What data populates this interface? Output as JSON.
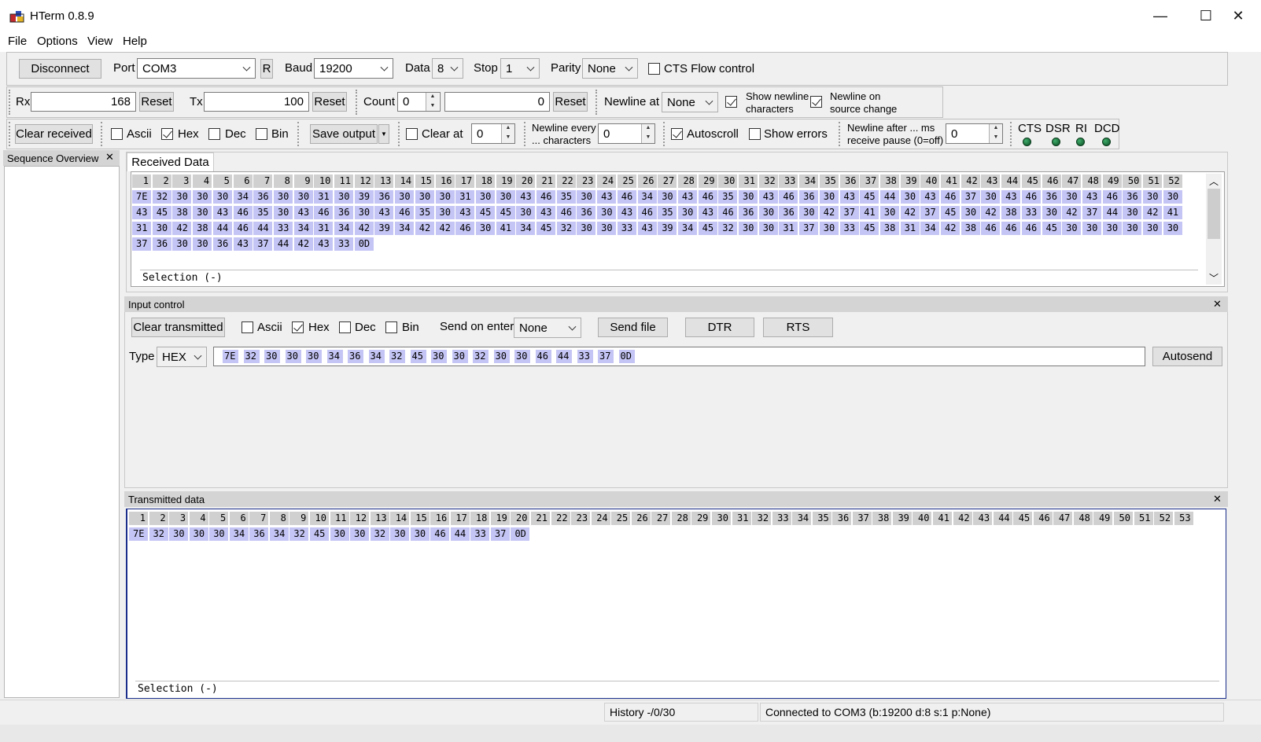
{
  "window": {
    "title": "HTerm 0.8.9",
    "minimize_glyph": "—",
    "maximize_glyph": "☐",
    "close_glyph": "✕"
  },
  "menu": [
    "File",
    "Options",
    "View",
    "Help"
  ],
  "connection": {
    "disconnect_label": "Disconnect",
    "port_label": "Port",
    "port_value": "COM3",
    "refresh_label": "R",
    "baud_label": "Baud",
    "baud_value": "19200",
    "data_label": "Data",
    "data_value": "8",
    "stop_label": "Stop",
    "stop_value": "1",
    "parity_label": "Parity",
    "parity_value": "None",
    "cts_label": "CTS Flow control",
    "cts_checked": false
  },
  "counters": {
    "rx_label": "Rx",
    "rx_value": "168",
    "rx_reset": "Reset",
    "tx_label": "Tx",
    "tx_value": "100",
    "tx_reset": "Reset",
    "count_label": "Count",
    "count_value": "0",
    "count_total": "0",
    "count_reset": "Reset",
    "newline_at_label": "Newline at",
    "newline_at_value": "None",
    "show_newline_label_1": "Show newline",
    "show_newline_label_2": "characters",
    "show_newline_checked": true,
    "newline_source_label_1": "Newline on",
    "newline_source_label_2": "source change",
    "newline_source_checked": true
  },
  "received_toolbar": {
    "clear_received": "Clear received",
    "ascii_label": "Ascii",
    "ascii_checked": false,
    "hex_label": "Hex",
    "hex_checked": true,
    "dec_label": "Dec",
    "dec_checked": false,
    "bin_label": "Bin",
    "bin_checked": false,
    "save_output": "Save output",
    "clear_at_label": "Clear at",
    "clear_at_checked": false,
    "clear_at_value": "0",
    "newline_every_label_1": "Newline every",
    "newline_every_label_2": "... characters",
    "newline_every_value": "0",
    "autoscroll_label": "Autoscroll",
    "autoscroll_checked": true,
    "show_errors_label": "Show errors",
    "show_errors_checked": false,
    "newline_after_label_1": "Newline after ... ms",
    "newline_after_label_2": "receive pause (0=off)",
    "newline_after_value": "0",
    "signals": [
      "CTS",
      "DSR",
      "RI",
      "DCD"
    ]
  },
  "sequence_overview": {
    "title": "Sequence Overview",
    "close_glyph": "✕"
  },
  "received": {
    "tab_label": "Received Data",
    "index_row_count": 52,
    "rows": [
      [
        "7E",
        "32",
        "30",
        "30",
        "30",
        "34",
        "36",
        "30",
        "30",
        "31",
        "30",
        "39",
        "36",
        "30",
        "30",
        "30",
        "31",
        "30",
        "30",
        "43",
        "46",
        "35",
        "30",
        "43",
        "46",
        "34",
        "30",
        "43",
        "46",
        "35",
        "30",
        "43",
        "46",
        "36",
        "30",
        "43",
        "45",
        "44",
        "30",
        "43",
        "46",
        "37",
        "30",
        "43",
        "46",
        "36",
        "30",
        "43",
        "46",
        "36",
        "30",
        "30"
      ],
      [
        "43",
        "45",
        "38",
        "30",
        "43",
        "46",
        "35",
        "30",
        "43",
        "46",
        "36",
        "30",
        "43",
        "46",
        "35",
        "30",
        "43",
        "45",
        "45",
        "30",
        "43",
        "46",
        "36",
        "30",
        "43",
        "46",
        "35",
        "30",
        "43",
        "46",
        "36",
        "30",
        "36",
        "30",
        "42",
        "37",
        "41",
        "30",
        "42",
        "37",
        "45",
        "30",
        "42",
        "38",
        "33",
        "30",
        "42",
        "37",
        "44",
        "30",
        "42",
        "41"
      ],
      [
        "31",
        "30",
        "42",
        "38",
        "44",
        "46",
        "44",
        "33",
        "34",
        "31",
        "34",
        "42",
        "39",
        "34",
        "42",
        "42",
        "46",
        "30",
        "41",
        "34",
        "45",
        "32",
        "30",
        "30",
        "33",
        "43",
        "39",
        "34",
        "45",
        "32",
        "30",
        "30",
        "31",
        "37",
        "30",
        "33",
        "45",
        "38",
        "31",
        "34",
        "42",
        "38",
        "46",
        "46",
        "46",
        "45",
        "30",
        "30",
        "30",
        "30",
        "30",
        "30"
      ],
      [
        "37",
        "36",
        "30",
        "30",
        "36",
        "43",
        "37",
        "44",
        "42",
        "43",
        "33",
        "0D"
      ]
    ],
    "selection_text": "Selection (-)"
  },
  "input_control": {
    "header": "Input control",
    "close_glyph": "✕",
    "clear_transmitted": "Clear transmitted",
    "ascii_label": "Ascii",
    "ascii_checked": false,
    "hex_label": "Hex",
    "hex_checked": true,
    "dec_label": "Dec",
    "dec_checked": false,
    "bin_label": "Bin",
    "bin_checked": false,
    "send_on_enter_label": "Send on enter",
    "send_on_enter_value": "None",
    "send_file": "Send file",
    "dtr": "DTR",
    "rts": "RTS",
    "type_label": "Type",
    "type_value": "HEX",
    "input_bytes": [
      "7E",
      "32",
      "30",
      "30",
      "30",
      "34",
      "36",
      "34",
      "32",
      "45",
      "30",
      "30",
      "32",
      "30",
      "30",
      "46",
      "44",
      "33",
      "37",
      "0D"
    ],
    "autosend": "Autosend"
  },
  "transmitted": {
    "header": "Transmitted data",
    "close_glyph": "✕",
    "index_row_count": 53,
    "rows": [
      [
        "7E",
        "32",
        "30",
        "30",
        "30",
        "34",
        "36",
        "34",
        "32",
        "45",
        "30",
        "30",
        "32",
        "30",
        "30",
        "46",
        "44",
        "33",
        "37",
        "0D"
      ]
    ],
    "selection_text": "Selection (-)"
  },
  "status": {
    "history": "History -/0/30",
    "connection": "Connected to COM3 (b:19200 d:8 s:1 p:None)"
  },
  "colors": {
    "byte_highlight": "#c5c5f5",
    "index_cell": "#d0d0d0",
    "led": "#1f7a43"
  }
}
